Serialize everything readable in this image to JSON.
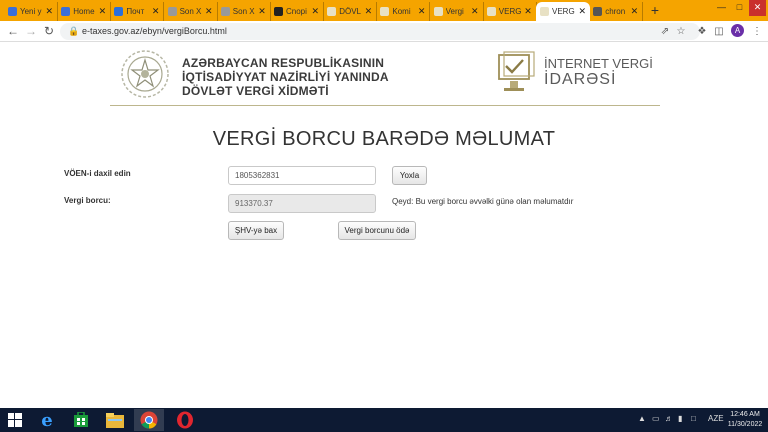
{
  "browser": {
    "tabs": [
      {
        "label": "Yeni y",
        "color": "#3b6fd8"
      },
      {
        "label": "Home",
        "color": "#3b6fd8"
      },
      {
        "label": "Почт",
        "color": "#2a6fdb"
      },
      {
        "label": "Son X",
        "color": "#999999"
      },
      {
        "label": "Son X",
        "color": "#999999"
      },
      {
        "label": "Сnopi",
        "color": "#222222"
      },
      {
        "label": "DÖVL",
        "color": "#e8e1c4"
      },
      {
        "label": "Komi",
        "color": "#e8e1c4"
      },
      {
        "label": "Vergi",
        "color": "#e8e1c4"
      },
      {
        "label": "VERG",
        "color": "#e8e1c4"
      },
      {
        "label": "VERG",
        "color": "#e8e1c4",
        "active": true
      },
      {
        "label": "chron",
        "color": "#555555"
      }
    ],
    "new_tab": "+",
    "url": "e-taxes.gov.az/ebyn/vergiBorcu.html",
    "avatar_letter": "A"
  },
  "header": {
    "org_line1": "AZƏRBAYCAN RESPUBLİKASININ",
    "org_line2": "İQTİSADİYYAT NAZİRLİYİ YANINDA",
    "org_line3": "DÖVLƏT VERGİ XİDMƏTİ",
    "portal_line1": "İNTERNET VERGİ",
    "portal_line2": "İDARƏSİ"
  },
  "main": {
    "title": "VERGİ BORCU BARƏDƏ MƏLUMAT",
    "voen_label": "VÖEN-i daxil edin",
    "voen_value": "1805362831",
    "check_button": "Yoxla",
    "debt_label": "Vergi borcu:",
    "debt_value": "913370.37",
    "note": "Qeyd: Bu vergi borcu əvvəlki günə olan məlumatdır",
    "shv_button": "ŞHV-yə bax",
    "pay_button": "Vergi borcunu ödə"
  },
  "taskbar": {
    "language": "AZE",
    "time": "12:46 AM",
    "date": "11/30/2022"
  },
  "colors": {
    "tabstrip": "#f5a400",
    "header_rule": "#bdb68d",
    "taskbar": "#0d1a33"
  }
}
